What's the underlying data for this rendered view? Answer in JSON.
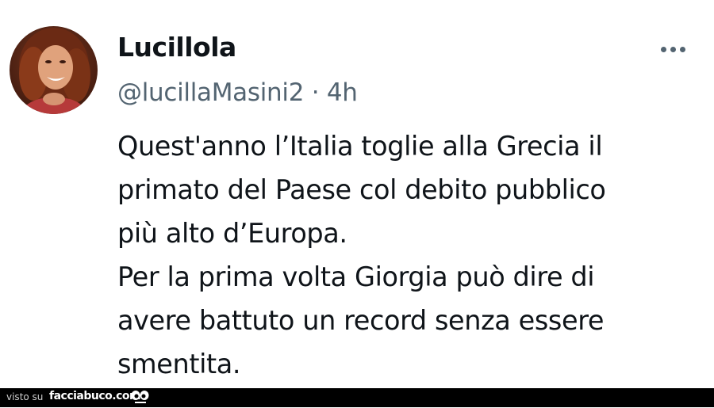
{
  "tweet": {
    "display_name": "Lucillola",
    "handle": "@lucillaMasini2",
    "separator": "·",
    "time": "4h",
    "text_lines": [
      "Quest'anno l’Italia toglie alla Grecia il",
      "primato del Paese col debito pubblico",
      "più alto d’Europa.",
      "Per la prima volta Giorgia può dire di",
      "avere battuto un record senza essere",
      "smentita."
    ],
    "more_icon": "more-horizontal-icon",
    "avatar_icon": "profile-photo"
  },
  "watermark": {
    "visto_su": "visto su",
    "site": "facciabuco.com",
    "logo_icon": "eyes-icon"
  },
  "colors": {
    "name_text": "#0f1419",
    "meta_text": "#536471",
    "background": "#ffffff",
    "watermark_bg": "#000000"
  }
}
